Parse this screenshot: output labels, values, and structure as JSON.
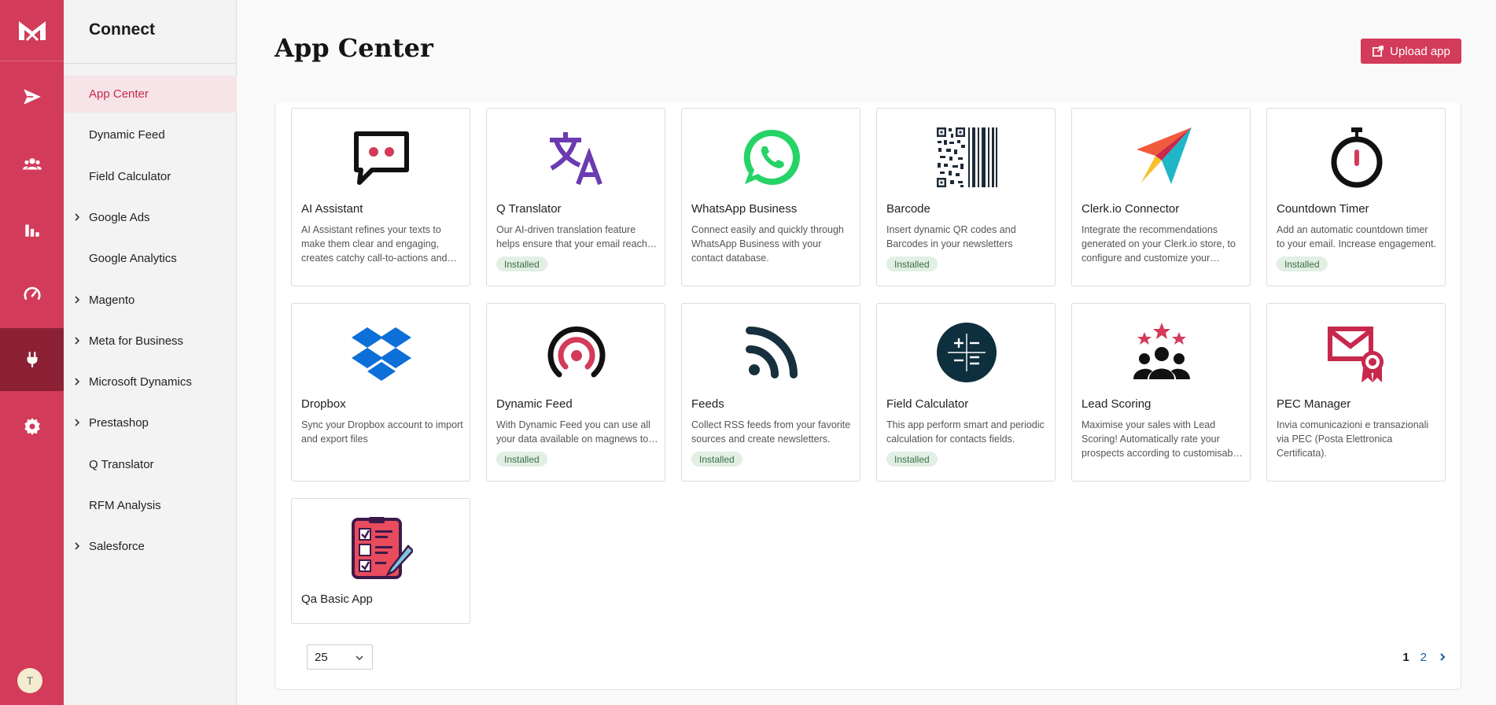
{
  "sidebar": {
    "title": "Connect",
    "items": [
      {
        "label": "App Center",
        "expandable": false,
        "active": true
      },
      {
        "label": "Dynamic Feed",
        "expandable": false
      },
      {
        "label": "Field Calculator",
        "expandable": false
      },
      {
        "label": "Google Ads",
        "expandable": true
      },
      {
        "label": "Google Analytics",
        "expandable": false
      },
      {
        "label": "Magento",
        "expandable": true
      },
      {
        "label": "Meta for Business",
        "expandable": true
      },
      {
        "label": "Microsoft Dynamics",
        "expandable": true
      },
      {
        "label": "Prestashop",
        "expandable": true
      },
      {
        "label": "Q Translator",
        "expandable": false
      },
      {
        "label": "RFM Analysis",
        "expandable": false
      },
      {
        "label": "Salesforce",
        "expandable": true
      }
    ]
  },
  "rail": {
    "icons": [
      "logo-icon",
      "send-icon",
      "contacts-icon",
      "bar-chart-icon",
      "gauge-icon",
      "plug-icon",
      "gear-icon"
    ],
    "avatar_initial": "T"
  },
  "header": {
    "title": "App Center",
    "upload_label": "Upload app"
  },
  "apps": [
    {
      "name": "AI Assistant",
      "description": "AI Assistant refines your texts to make them clear and engaging, creates catchy call-to-actions and more.",
      "installed": false,
      "icon": "chat-bubble-icon"
    },
    {
      "name": "Q Translator",
      "description": "Our AI-driven translation feature helps ensure that your email reaches everyone.",
      "installed": true,
      "icon": "translate-icon"
    },
    {
      "name": "WhatsApp Business",
      "description": "Connect easily and quickly through WhatsApp Business with your contact database.",
      "installed": false,
      "icon": "whatsapp-icon"
    },
    {
      "name": "Barcode",
      "description": "Insert dynamic QR codes and Barcodes in your newsletters",
      "installed": true,
      "icon": "barcode-icon"
    },
    {
      "name": "Clerk.io Connector",
      "description": "Integrate the recommendations generated on your Clerk.io store, to configure and customize your emails.",
      "installed": false,
      "icon": "clerk-icon"
    },
    {
      "name": "Countdown Timer",
      "description": "Add an automatic countdown timer to your email. Increase engagement.",
      "installed": true,
      "icon": "stopwatch-icon"
    },
    {
      "name": "Dropbox",
      "description": "Sync your Dropbox account to import and export files",
      "installed": false,
      "icon": "dropbox-icon"
    },
    {
      "name": "Dynamic Feed",
      "description": "With Dynamic Feed you can use all your data available on magnews to personalize.",
      "installed": true,
      "icon": "dynamic-feed-icon"
    },
    {
      "name": "Feeds",
      "description": "Collect RSS feeds from your favorite sources and create newsletters.",
      "installed": true,
      "icon": "rss-icon"
    },
    {
      "name": "Field Calculator",
      "description": "This app perform smart and periodic calculation for contacts fields.",
      "installed": true,
      "icon": "calculator-icon"
    },
    {
      "name": "Lead Scoring",
      "description": "Maximise your sales with Lead Scoring! Automatically rate your prospects according to customisable rules.",
      "installed": false,
      "icon": "lead-scoring-icon"
    },
    {
      "name": "PEC Manager",
      "description": "Invia comunicazioni e transazionali via PEC (Posta Elettronica Certificata).",
      "installed": false,
      "icon": "certified-mail-icon"
    },
    {
      "name": "Qa Basic App",
      "description": "",
      "installed": false,
      "icon": "checklist-icon"
    }
  ],
  "installed_label": "Installed",
  "pagination": {
    "per_page": "25",
    "pages": [
      "1",
      "2"
    ],
    "current": "1"
  },
  "colors": {
    "brand": "#d33b5a",
    "rail_active": "#8c2136",
    "installed_bg": "#e2efe4",
    "link": "#1d5a9c"
  }
}
